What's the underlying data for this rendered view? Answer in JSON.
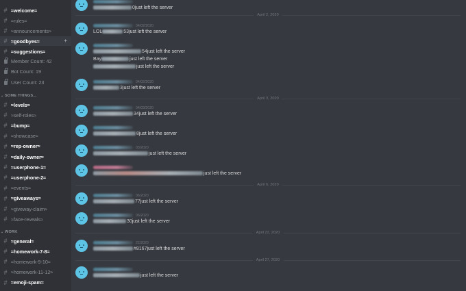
{
  "sidebar": {
    "channels_top": [
      {
        "label": "≈welcome≈",
        "bold": true
      },
      {
        "label": "≈rules≈",
        "bold": false
      },
      {
        "label": "≈announcements≈",
        "bold": false
      },
      {
        "label": "≈goodbyes≈",
        "bold": true,
        "active": true,
        "add_icon": "add-member-icon"
      },
      {
        "label": "≈suggestions≈",
        "bold": true
      }
    ],
    "stats": [
      {
        "label": "Member Count: 42",
        "icon": "lock-icon"
      },
      {
        "label": "Bot Count: 19",
        "icon": "lock-icon"
      },
      {
        "label": "User Count: 23",
        "icon": "lock-icon"
      }
    ],
    "categories": [
      {
        "label": "SOME THINGS...",
        "channels": [
          {
            "label": "≈levels≈",
            "bold": true
          },
          {
            "label": "≈self-roles≈",
            "bold": false
          },
          {
            "label": "≈bump≈",
            "bold": true
          },
          {
            "label": "≈showcase≈",
            "bold": false
          },
          {
            "label": "≈rep-owner≈",
            "bold": true
          },
          {
            "label": "≈daily-owner≈",
            "bold": true
          },
          {
            "label": "≈userphone-1≈",
            "bold": true
          },
          {
            "label": "≈userphone-2≈",
            "bold": true
          },
          {
            "label": "≈events≈",
            "bold": false
          },
          {
            "label": "≈giveaways≈",
            "bold": true
          },
          {
            "label": "≈giveway-claim≈",
            "bold": false
          },
          {
            "label": "≈face-reveals≈",
            "bold": false
          }
        ]
      },
      {
        "label": "WORK",
        "channels": [
          {
            "label": "≈general≈",
            "bold": true
          },
          {
            "label": "≈homework-7-8≈",
            "bold": true
          },
          {
            "label": "≈homework-9-10≈",
            "bold": false
          },
          {
            "label": "≈homework-11-12≈",
            "bold": false
          },
          {
            "label": "≈emoji-spam≈",
            "bold": true
          }
        ]
      }
    ]
  },
  "chat": {
    "date_dividers": [
      "April 2, 2020",
      "April 3, 2020",
      "April 6, 2020",
      "April 22, 2020",
      "April 27, 2020"
    ],
    "messages": [
      {
        "name_color": "blue",
        "timestamp": "",
        "lines": [
          {
            "visible_prefix": "",
            "visible_tail": "0",
            "text": " just left the server"
          }
        ]
      },
      {
        "name_color": "blue",
        "timestamp": "04/02/2020",
        "lines": [
          {
            "visible_prefix": "LOL",
            "visible_tail": "53",
            "text": " just left the server"
          }
        ]
      },
      {
        "name_color": "blue",
        "timestamp": "",
        "lines": [
          {
            "visible_prefix": "",
            "visible_tail": "54",
            "text": " just left the server"
          },
          {
            "visible_prefix": "Bay",
            "visible_tail": "",
            "text": " just left the server"
          },
          {
            "visible_prefix": "",
            "visible_tail": "",
            "text": " just left the server"
          }
        ]
      },
      {
        "name_color": "blue",
        "timestamp": "04/02/2020",
        "lines": [
          {
            "visible_prefix": "",
            "visible_tail": "3",
            "text": " just left the server"
          }
        ]
      },
      {
        "name_color": "blue",
        "timestamp": "04/03/2020",
        "lines": [
          {
            "visible_prefix": "",
            "visible_tail": "34",
            "text": " just left the server"
          }
        ]
      },
      {
        "name_color": "blue",
        "timestamp": "",
        "lines": [
          {
            "visible_prefix": "",
            "visible_tail": "8",
            "text": " just left the server"
          }
        ]
      },
      {
        "name_color": "blue",
        "timestamp": "03/2020",
        "lines": [
          {
            "visible_prefix": "",
            "visible_tail": "",
            "text": " just left the server"
          }
        ]
      },
      {
        "name_color": "pink",
        "timestamp": "",
        "lines": [
          {
            "visible_prefix": "",
            "visible_tail": "",
            "text": " just left the server"
          }
        ]
      },
      {
        "name_color": "blue",
        "timestamp": "06/2020",
        "lines": [
          {
            "visible_prefix": "",
            "visible_tail": "77",
            "text": " just left the server"
          }
        ]
      },
      {
        "name_color": "blue",
        "timestamp": "06/2020",
        "lines": [
          {
            "visible_prefix": "",
            "visible_tail": "30",
            "text": " just left the server"
          }
        ]
      },
      {
        "name_color": "blue",
        "timestamp": "22/2020",
        "lines": [
          {
            "visible_prefix": "",
            "visible_tail": "#8167",
            "text": " just left the server"
          }
        ]
      },
      {
        "name_color": "blue",
        "timestamp": "",
        "lines": [
          {
            "visible_prefix": "",
            "visible_tail": "",
            "text": " just left the server"
          }
        ]
      }
    ]
  },
  "colors": {
    "sidebar_bg": "#2f3136",
    "chat_bg": "#36393f",
    "avatar": "#5ec4e6",
    "text": "#dcddde",
    "muted": "#8e9297"
  }
}
